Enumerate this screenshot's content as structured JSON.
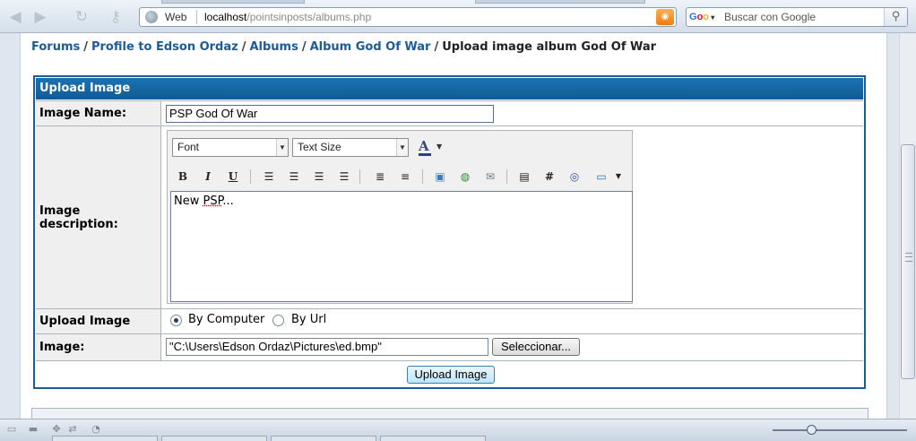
{
  "browser": {
    "address_label": "Web",
    "url_host": "localhost",
    "url_path": "/pointsinposts/albums.php",
    "search_placeholder": "Buscar con Google"
  },
  "breadcrumb": {
    "items": [
      "Forums",
      "Profile to Edson Ordaz",
      "Albums",
      "Album God Of War"
    ],
    "current": "Upload image album God Of War"
  },
  "form": {
    "header": "Upload Image",
    "image_name_label": "Image Name:",
    "image_name_value": "PSP God Of War",
    "description_label": "Image description:",
    "editor": {
      "font_select": "Font",
      "size_select": "Text Size",
      "color_glyph": "A",
      "content_prefix": "New ",
      "content_misspelled": "PSP",
      "content_suffix": "..."
    },
    "upload_label": "Upload Image",
    "radio_computer": "By Computer",
    "radio_url": "By Url",
    "image_label": "Image:",
    "file_value": "\"C:\\Users\\Edson Ordaz\\Pictures\\ed.bmp\"",
    "browse_button": "Seleccionar...",
    "submit_button": "Upload Image"
  }
}
